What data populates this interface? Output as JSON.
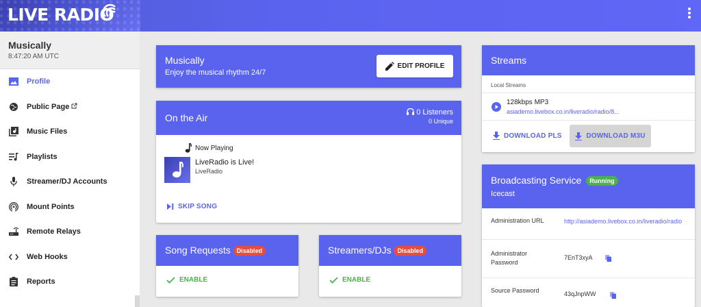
{
  "brand": {
    "logo_text": "LIVE RADIO"
  },
  "colors": {
    "primary": "#5a63ee",
    "success": "#4caf50",
    "danger": "#e74c3c"
  },
  "sidebar": {
    "station_name": "Musically",
    "time": "8:47:20 AM UTC",
    "items": [
      {
        "label": "Profile",
        "icon": "image-icon",
        "active": true
      },
      {
        "label": "Public Page",
        "icon": "globe-icon"
      },
      {
        "label": "Music Files",
        "icon": "music-library-icon"
      },
      {
        "label": "Playlists",
        "icon": "playlist-icon"
      },
      {
        "label": "Streamer/DJ Accounts",
        "icon": "microphone-icon"
      },
      {
        "label": "Mount Points",
        "icon": "broadcast-icon"
      },
      {
        "label": "Remote Relays",
        "icon": "router-icon"
      },
      {
        "label": "Web Hooks",
        "icon": "code-icon"
      },
      {
        "label": "Reports",
        "icon": "clipboard-icon"
      }
    ]
  },
  "profile": {
    "title": "Musically",
    "description": "Enjoy the musical rhythm 24/7",
    "edit_label": "EDIT PROFILE"
  },
  "on_air": {
    "title": "On the Air",
    "listeners": "0 Listeners",
    "unique": "0 Unique",
    "now_playing_label": "Now Playing",
    "song_title": "LiveRadio is Live!",
    "song_artist": "LiveRadio",
    "skip_label": "SKIP SONG"
  },
  "song_requests": {
    "title": "Song Requests",
    "status": "Disabled",
    "action": "ENABLE"
  },
  "streamers": {
    "title": "Streamers/DJs",
    "status": "Disabled",
    "action": "ENABLE"
  },
  "streams": {
    "title": "Streams",
    "local_label": "Local Streams",
    "stream_name": "128kbps MP3",
    "stream_url": "asiademo.livebox.co.in/liveradio/radio/8...",
    "download_pls": "DOWNLOAD PLS",
    "download_m3u": "DOWNLOAD M3U"
  },
  "broadcasting": {
    "title": "Broadcasting Service",
    "status": "Running",
    "subtitle": "Icecast",
    "rows": [
      {
        "key": "Administration URL",
        "value": "http://asiademo.livebox.co.in/liveradio/radio"
      },
      {
        "key": "Administrator Password",
        "value": "7EnT3xyA"
      },
      {
        "key": "Source Password",
        "value": "43qJnpWW"
      }
    ]
  }
}
